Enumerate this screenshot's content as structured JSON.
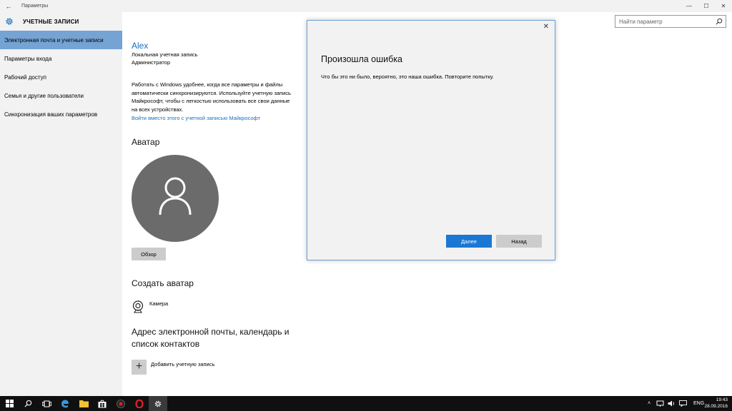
{
  "window": {
    "title": "Параметры",
    "back_glyph": "←",
    "minimize_glyph": "—",
    "maximize_glyph": "☐",
    "close_glyph": "✕"
  },
  "sidebar": {
    "header": "УЧЕТНЫЕ ЗАПИСИ",
    "items": [
      {
        "label": "Электронная почта и учетные записи",
        "active": true
      },
      {
        "label": "Параметры входа"
      },
      {
        "label": "Рабочий доступ"
      },
      {
        "label": "Семья и другие пользователи"
      },
      {
        "label": "Синхронизация ваших параметров"
      }
    ]
  },
  "search": {
    "placeholder": "Найти параметр"
  },
  "account": {
    "name": "Alex",
    "type": "Локальная учетная запись",
    "role": "Администратор",
    "description": "Работать с Windows удобнее, когда все параметры и файлы автоматически синхронизируются. Используйте учетную запись Майкрософт, чтобы с легкостью использовать все свои данные на всех устройствах.",
    "signin_link": "Войти вместо этого с учетной записью Майкрософт"
  },
  "avatar_section": {
    "title": "Аватар",
    "browse_label": "Обзор"
  },
  "create_avatar": {
    "title": "Создать аватар",
    "camera_label": "Камера"
  },
  "email_section": {
    "title": "Адрес электронной почты, календарь и список контактов",
    "add_label": "Добавить учетную запись",
    "add_glyph": "+"
  },
  "dialog": {
    "title": "Произошла ошибка",
    "message": "Что бы это ни было, вероятно, это наша ошибка. Повторите попытку.",
    "next_label": "Далее",
    "back_label": "Назад",
    "close_glyph": "✕"
  },
  "taskbar": {
    "language": "ENG",
    "time": "19:43",
    "date": "28.09.2016"
  },
  "colors": {
    "accent": "#1a78d4",
    "link": "#1a6fc2",
    "sidebar_active": "#74a3d4",
    "taskbar": "#101010"
  }
}
